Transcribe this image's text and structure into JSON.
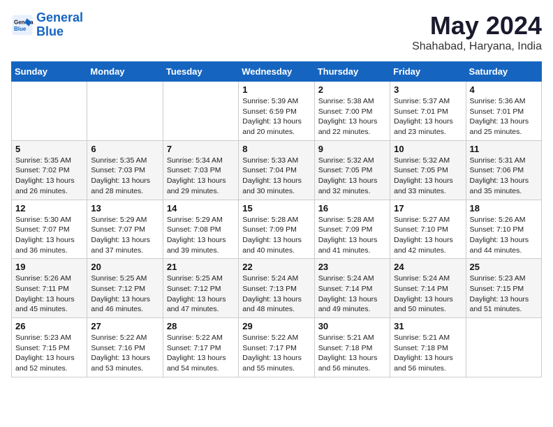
{
  "header": {
    "logo_line1": "General",
    "logo_line2": "Blue",
    "month_year": "May 2024",
    "location": "Shahabad, Haryana, India"
  },
  "weekdays": [
    "Sunday",
    "Monday",
    "Tuesday",
    "Wednesday",
    "Thursday",
    "Friday",
    "Saturday"
  ],
  "weeks": [
    [
      {
        "day": "",
        "info": ""
      },
      {
        "day": "",
        "info": ""
      },
      {
        "day": "",
        "info": ""
      },
      {
        "day": "1",
        "info": "Sunrise: 5:39 AM\nSunset: 6:59 PM\nDaylight: 13 hours\nand 20 minutes."
      },
      {
        "day": "2",
        "info": "Sunrise: 5:38 AM\nSunset: 7:00 PM\nDaylight: 13 hours\nand 22 minutes."
      },
      {
        "day": "3",
        "info": "Sunrise: 5:37 AM\nSunset: 7:01 PM\nDaylight: 13 hours\nand 23 minutes."
      },
      {
        "day": "4",
        "info": "Sunrise: 5:36 AM\nSunset: 7:01 PM\nDaylight: 13 hours\nand 25 minutes."
      }
    ],
    [
      {
        "day": "5",
        "info": "Sunrise: 5:35 AM\nSunset: 7:02 PM\nDaylight: 13 hours\nand 26 minutes."
      },
      {
        "day": "6",
        "info": "Sunrise: 5:35 AM\nSunset: 7:03 PM\nDaylight: 13 hours\nand 28 minutes."
      },
      {
        "day": "7",
        "info": "Sunrise: 5:34 AM\nSunset: 7:03 PM\nDaylight: 13 hours\nand 29 minutes."
      },
      {
        "day": "8",
        "info": "Sunrise: 5:33 AM\nSunset: 7:04 PM\nDaylight: 13 hours\nand 30 minutes."
      },
      {
        "day": "9",
        "info": "Sunrise: 5:32 AM\nSunset: 7:05 PM\nDaylight: 13 hours\nand 32 minutes."
      },
      {
        "day": "10",
        "info": "Sunrise: 5:32 AM\nSunset: 7:05 PM\nDaylight: 13 hours\nand 33 minutes."
      },
      {
        "day": "11",
        "info": "Sunrise: 5:31 AM\nSunset: 7:06 PM\nDaylight: 13 hours\nand 35 minutes."
      }
    ],
    [
      {
        "day": "12",
        "info": "Sunrise: 5:30 AM\nSunset: 7:07 PM\nDaylight: 13 hours\nand 36 minutes."
      },
      {
        "day": "13",
        "info": "Sunrise: 5:29 AM\nSunset: 7:07 PM\nDaylight: 13 hours\nand 37 minutes."
      },
      {
        "day": "14",
        "info": "Sunrise: 5:29 AM\nSunset: 7:08 PM\nDaylight: 13 hours\nand 39 minutes."
      },
      {
        "day": "15",
        "info": "Sunrise: 5:28 AM\nSunset: 7:09 PM\nDaylight: 13 hours\nand 40 minutes."
      },
      {
        "day": "16",
        "info": "Sunrise: 5:28 AM\nSunset: 7:09 PM\nDaylight: 13 hours\nand 41 minutes."
      },
      {
        "day": "17",
        "info": "Sunrise: 5:27 AM\nSunset: 7:10 PM\nDaylight: 13 hours\nand 42 minutes."
      },
      {
        "day": "18",
        "info": "Sunrise: 5:26 AM\nSunset: 7:10 PM\nDaylight: 13 hours\nand 44 minutes."
      }
    ],
    [
      {
        "day": "19",
        "info": "Sunrise: 5:26 AM\nSunset: 7:11 PM\nDaylight: 13 hours\nand 45 minutes."
      },
      {
        "day": "20",
        "info": "Sunrise: 5:25 AM\nSunset: 7:12 PM\nDaylight: 13 hours\nand 46 minutes."
      },
      {
        "day": "21",
        "info": "Sunrise: 5:25 AM\nSunset: 7:12 PM\nDaylight: 13 hours\nand 47 minutes."
      },
      {
        "day": "22",
        "info": "Sunrise: 5:24 AM\nSunset: 7:13 PM\nDaylight: 13 hours\nand 48 minutes."
      },
      {
        "day": "23",
        "info": "Sunrise: 5:24 AM\nSunset: 7:14 PM\nDaylight: 13 hours\nand 49 minutes."
      },
      {
        "day": "24",
        "info": "Sunrise: 5:24 AM\nSunset: 7:14 PM\nDaylight: 13 hours\nand 50 minutes."
      },
      {
        "day": "25",
        "info": "Sunrise: 5:23 AM\nSunset: 7:15 PM\nDaylight: 13 hours\nand 51 minutes."
      }
    ],
    [
      {
        "day": "26",
        "info": "Sunrise: 5:23 AM\nSunset: 7:15 PM\nDaylight: 13 hours\nand 52 minutes."
      },
      {
        "day": "27",
        "info": "Sunrise: 5:22 AM\nSunset: 7:16 PM\nDaylight: 13 hours\nand 53 minutes."
      },
      {
        "day": "28",
        "info": "Sunrise: 5:22 AM\nSunset: 7:17 PM\nDaylight: 13 hours\nand 54 minutes."
      },
      {
        "day": "29",
        "info": "Sunrise: 5:22 AM\nSunset: 7:17 PM\nDaylight: 13 hours\nand 55 minutes."
      },
      {
        "day": "30",
        "info": "Sunrise: 5:21 AM\nSunset: 7:18 PM\nDaylight: 13 hours\nand 56 minutes."
      },
      {
        "day": "31",
        "info": "Sunrise: 5:21 AM\nSunset: 7:18 PM\nDaylight: 13 hours\nand 56 minutes."
      },
      {
        "day": "",
        "info": ""
      }
    ]
  ]
}
